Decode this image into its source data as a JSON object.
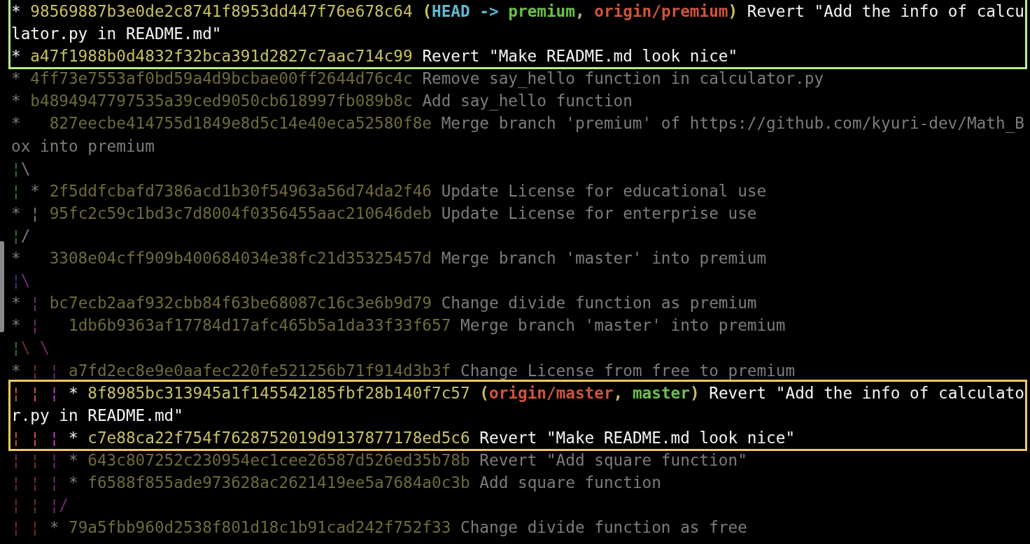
{
  "terminal": {
    "blocks": [
      {
        "framed": true,
        "color": "#b4f08c",
        "lines": [
          {
            "kind": "commit",
            "graph": [
              {
                "text": "* ",
                "color": "#f0f0f0"
              }
            ],
            "hash": "98569887b3e0de2c8741f8953dd447f76e678c64",
            "refs": [
              {
                "text": "(",
                "color": "#c8c060"
              },
              {
                "text": "HEAD -> ",
                "color": "#5fb8d0"
              },
              {
                "text": "premium",
                "color": "#6cc04a"
              },
              {
                "text": ", ",
                "color": "#c8c060"
              },
              {
                "text": "origin/premium",
                "color": "#d0543a"
              },
              {
                "text": ")",
                "color": "#c8c060"
              }
            ],
            "message": "Revert \"Add the info of calcu"
          },
          {
            "kind": "wrap",
            "text": "lator.py in README.md\""
          },
          {
            "kind": "commit",
            "graph": [
              {
                "text": "* ",
                "color": "#f0f0f0"
              }
            ],
            "hash": "a47f1988b0d4832f32bca391d2827c7aac714c99",
            "message": "Revert \"Make README.md look nice\""
          }
        ]
      },
      {
        "framed": false,
        "lines": [
          {
            "kind": "commit",
            "graph": [
              {
                "text": "* ",
                "color": "#7a7a7a"
              }
            ],
            "hash": "4ff73e7553af0bd59a4d9bcbae00ff2644d76c4c",
            "message": "Remove say_hello function in calculator.py"
          },
          {
            "kind": "commit",
            "graph": [
              {
                "text": "* ",
                "color": "#7a7a7a"
              }
            ],
            "hash": "b4894947797535a39ced9050cb618997fb089b8c",
            "message": "Add say_hello function"
          },
          {
            "kind": "commit",
            "graph": [
              {
                "text": "*   ",
                "color": "#7a7a7a"
              }
            ],
            "hash": "827eecbe414755d1849e8d5c14e40eca52580f8e",
            "message": "Merge branch 'premium' of https://github.com/kyuri-dev/Math_B"
          },
          {
            "kind": "wrap",
            "text": "ox into premium"
          },
          {
            "kind": "graph",
            "graph": [
              {
                "text": "¦",
                "color": "#2e7a32"
              },
              {
                "text": "\\",
                "color": "#7a7a7a"
              }
            ]
          },
          {
            "kind": "commit",
            "graph": [
              {
                "text": "¦ ",
                "color": "#2e7a32"
              },
              {
                "text": "* ",
                "color": "#7a7a7a"
              }
            ],
            "hash": "2f5ddfcbafd7386acd1b30f54963a56d74da2f46",
            "message": "Update License for educational use"
          },
          {
            "kind": "commit",
            "graph": [
              {
                "text": "* ",
                "color": "#7a7a7a"
              },
              {
                "text": "¦ ",
                "color": "#7a7a7a"
              }
            ],
            "hash": "95fc2c59c1bd3c7d8004f0356455aac210646deb",
            "message": "Update License for enterprise use"
          },
          {
            "kind": "graph",
            "graph": [
              {
                "text": "¦",
                "color": "#2e7a32"
              },
              {
                "text": "/",
                "color": "#7a7a7a"
              }
            ]
          },
          {
            "kind": "commit",
            "graph": [
              {
                "text": "*   ",
                "color": "#7a7a7a"
              }
            ],
            "hash": "3308e04cff909b400684034e38fc21d35325457d",
            "message": "Merge branch 'master' into premium"
          },
          {
            "kind": "graph",
            "graph": [
              {
                "text": "¦",
                "color": "#303c90"
              },
              {
                "text": "\\",
                "color": "#7a2a7a"
              }
            ]
          },
          {
            "kind": "commit",
            "graph": [
              {
                "text": "* ",
                "color": "#7a7a7a"
              },
              {
                "text": "¦ ",
                "color": "#7a2a7a"
              }
            ],
            "hash": "bc7ecb2aaf932cbb84f63be68087c16c3e6b9d79",
            "message": "Change divide function as premium"
          },
          {
            "kind": "commit",
            "graph": [
              {
                "text": "* ",
                "color": "#7a7a7a"
              },
              {
                "text": "¦   ",
                "color": "#7a2a7a"
              }
            ],
            "hash": "1db6b9363af17784d17afc465b5a1da33f33f657",
            "message": "Merge branch 'master' into premium"
          },
          {
            "kind": "graph",
            "graph": [
              {
                "text": "¦",
                "color": "#2e7a32"
              },
              {
                "text": "\\",
                "color": "#7a3020"
              },
              {
                "text": " \\",
                "color": "#7a2a7a"
              }
            ]
          },
          {
            "kind": "commit",
            "graph": [
              {
                "text": "* ",
                "color": "#7a7a7a"
              },
              {
                "text": "¦ ",
                "color": "#7a3020"
              },
              {
                "text": "¦ ",
                "color": "#7a2a7a"
              }
            ],
            "hash": "a7fd2ec8e9e0aafec220fe521256b71f914d3b3f",
            "message": "Change License from free to premium"
          }
        ]
      },
      {
        "framed": true,
        "color": "#f0c860",
        "lines": [
          {
            "kind": "commit",
            "graph": [
              {
                "text": "¦ ¦ ",
                "color": "#d0543a"
              },
              {
                "text": "¦ ",
                "color": "#c040c0"
              },
              {
                "text": "* ",
                "color": "#f0f0f0"
              }
            ],
            "hash": "8f8985bc313945a1f145542185fbf28b140f7c57",
            "refs": [
              {
                "text": "(",
                "color": "#c8c060"
              },
              {
                "text": "origin/master",
                "color": "#d0543a"
              },
              {
                "text": ", ",
                "color": "#c8c060"
              },
              {
                "text": "master",
                "color": "#6cc04a"
              },
              {
                "text": ")",
                "color": "#c8c060"
              }
            ],
            "message": "Revert \"Add the info of calculato"
          },
          {
            "kind": "wrap",
            "text": "r.py in README.md\""
          },
          {
            "kind": "commit",
            "graph": [
              {
                "text": "¦ ¦ ",
                "color": "#d0543a"
              },
              {
                "text": "¦ ",
                "color": "#c040c0"
              },
              {
                "text": "* ",
                "color": "#f0f0f0"
              }
            ],
            "hash": "c7e88ca22f754f7628752019d9137877178ed5c6",
            "message": "Revert \"Make README.md look nice\""
          }
        ]
      },
      {
        "framed": false,
        "lines": [
          {
            "kind": "commit",
            "graph": [
              {
                "text": "¦ ¦ ",
                "color": "#7a3020"
              },
              {
                "text": "¦ ",
                "color": "#7a2a7a"
              },
              {
                "text": "* ",
                "color": "#7a7a7a"
              }
            ],
            "hash": "643c807252c230954ec1cee26587d526ed35b78b",
            "message": "Revert \"Add square function\""
          },
          {
            "kind": "commit",
            "graph": [
              {
                "text": "¦ ¦ ",
                "color": "#7a3020"
              },
              {
                "text": "¦ ",
                "color": "#7a2a7a"
              },
              {
                "text": "* ",
                "color": "#7a7a7a"
              }
            ],
            "hash": "f6588f855ade973628ac2621419ee5a7684a0c3b",
            "message": "Add square function"
          },
          {
            "kind": "graph",
            "graph": [
              {
                "text": "¦ ¦ ",
                "color": "#7a3020"
              },
              {
                "text": "¦/",
                "color": "#7a2a7a"
              }
            ]
          },
          {
            "kind": "commit",
            "graph": [
              {
                "text": "¦ ¦ ",
                "color": "#7a3020"
              },
              {
                "text": "* ",
                "color": "#7a7a7a"
              }
            ],
            "hash": "79a5fbb960d2538f801d18c1b91cad242f752f33",
            "message": "Change divide function as free"
          }
        ]
      }
    ]
  }
}
